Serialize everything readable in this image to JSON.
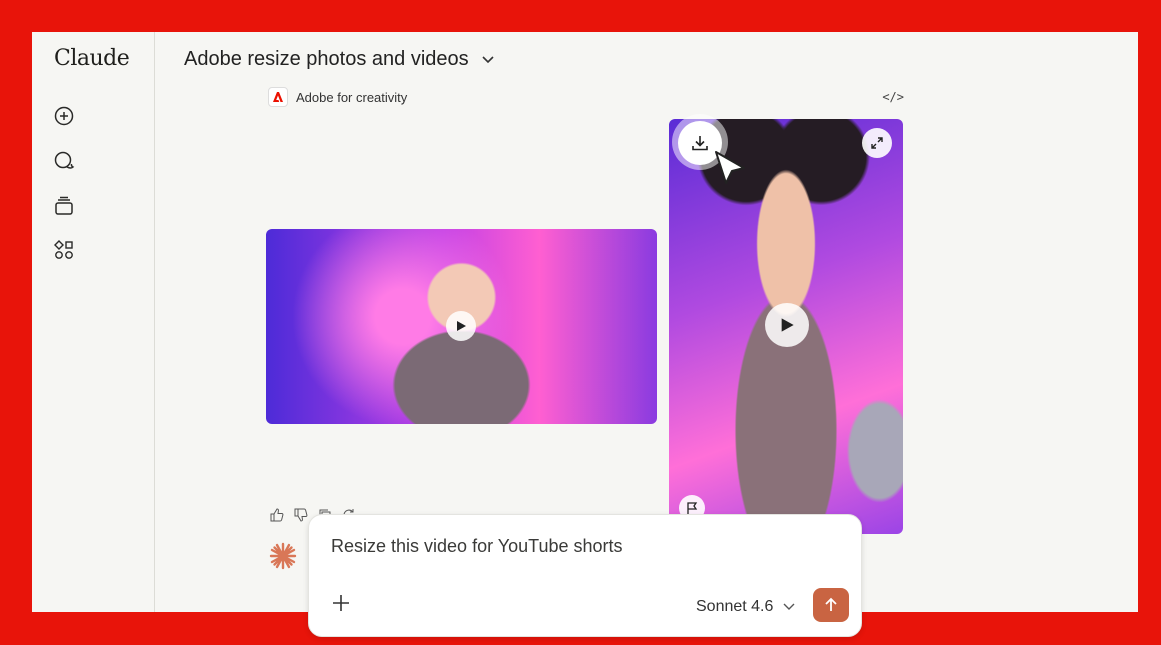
{
  "app": {
    "logo": "Claude"
  },
  "sidebar": {
    "icons": [
      "new-chat-icon",
      "chats-icon",
      "projects-icon",
      "artifacts-icon"
    ]
  },
  "header": {
    "title": "Adobe resize photos and videos"
  },
  "artifact": {
    "source_label": "Adobe for creativity",
    "code_label": "</>"
  },
  "colors": {
    "frame": "#e8140a",
    "accent": "#c96442",
    "adobe_red": "#eb1000"
  },
  "composer": {
    "prompt_text": "Resize this video for YouTube shorts",
    "model_label": "Sonnet 4.6"
  }
}
